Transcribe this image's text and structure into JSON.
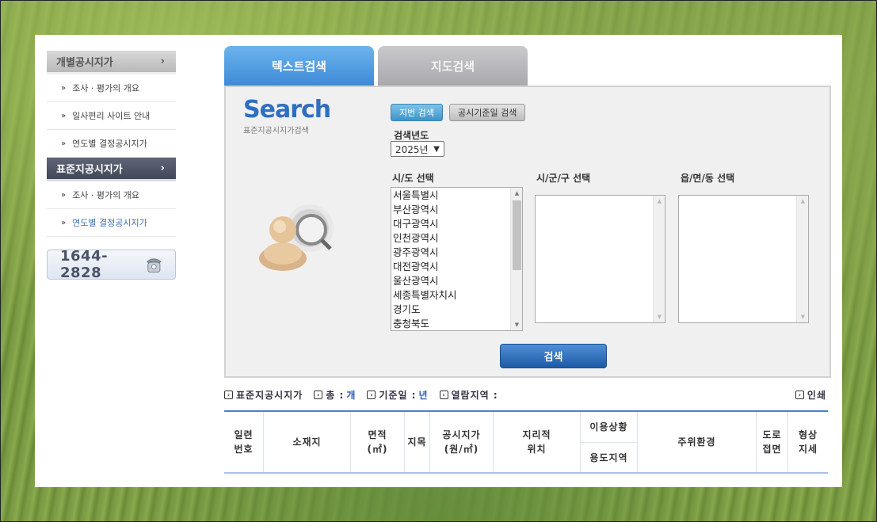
{
  "sidebar": {
    "section1_title": "개별공시지가",
    "section1_items": [
      "조사 · 평가의 개요",
      "일사편리 사이트 안내",
      "연도별 결정공시지가"
    ],
    "section2_title": "표준지공시지가",
    "section2_items": [
      "조사 · 평가의 개요",
      "연도별 결정공시지가"
    ],
    "phone": "1644-2828"
  },
  "tabs": {
    "text_search": "텍스트검색",
    "map_search": "지도검색"
  },
  "search": {
    "logo_title": "Search",
    "logo_subtitle": "표준지공시지가검색",
    "btn_lot": "지번 검색",
    "btn_date": "공시기준일 검색",
    "year_label": "검색년도",
    "year_value": "2025년",
    "sido_label": "시/도 선택",
    "sigungu_label": "시/군/구 선택",
    "eupmyeon_label": "읍/면/동 선택",
    "sido_options": [
      "서울특별시",
      "부산광역시",
      "대구광역시",
      "인천광역시",
      "광주광역시",
      "대전광역시",
      "울산광역시",
      "세종특별자치시",
      "경기도",
      "충청북도"
    ],
    "search_button": "검색"
  },
  "info": {
    "title": "표준지공시지가",
    "total_label": "총 :",
    "total_unit": "개",
    "date_label": "기준일 :",
    "date_unit": "년",
    "region_label": "열람지역 :",
    "print": "인쇄"
  },
  "table": {
    "col_no": [
      "일련",
      "번호"
    ],
    "col_location": "소재지",
    "col_area": [
      "면적",
      "(㎡)"
    ],
    "col_jimok": "지목",
    "col_price": [
      "공시지가",
      "(원/㎡)"
    ],
    "col_geo": [
      "지리적",
      "위치"
    ],
    "col_use_status": "이용상황",
    "col_use_zone": "용도지역",
    "col_surround": "주위환경",
    "col_road": [
      "도로",
      "접면"
    ],
    "col_shape": [
      "형상",
      "지세"
    ]
  }
}
